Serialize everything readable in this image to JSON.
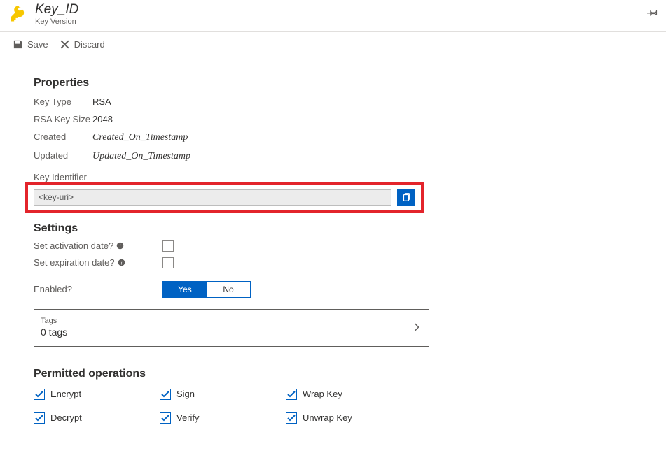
{
  "header": {
    "title": "Key_ID",
    "subtitle": "Key Version"
  },
  "toolbar": {
    "save_label": "Save",
    "discard_label": "Discard"
  },
  "properties": {
    "heading": "Properties",
    "key_type_label": "Key Type",
    "key_type_value": "RSA",
    "rsa_size_label": "RSA Key Size",
    "rsa_size_value": "2048",
    "created_label": "Created",
    "created_value": "Created_On_Timestamp",
    "updated_label": "Updated",
    "updated_value": "Updated_On_Timestamp",
    "key_identifier_label": "Key Identifier",
    "key_identifier_value": "<key-uri>"
  },
  "settings": {
    "heading": "Settings",
    "activation_label": "Set activation date?",
    "expiration_label": "Set expiration date?",
    "enabled_label": "Enabled?",
    "yes_label": "Yes",
    "no_label": "No",
    "enabled_value": "Yes"
  },
  "tags": {
    "label": "Tags",
    "count_text": "0 tags"
  },
  "permitted": {
    "heading": "Permitted operations",
    "items": [
      {
        "label": "Encrypt",
        "checked": true
      },
      {
        "label": "Sign",
        "checked": true
      },
      {
        "label": "Wrap Key",
        "checked": true
      },
      {
        "label": "Decrypt",
        "checked": true
      },
      {
        "label": "Verify",
        "checked": true
      },
      {
        "label": "Unwrap Key",
        "checked": true
      }
    ]
  }
}
